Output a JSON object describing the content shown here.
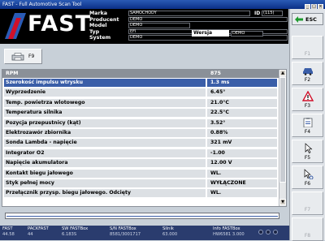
{
  "window": {
    "title": "FAST - Full Automotive Scan Tool"
  },
  "header": {
    "logo": "FAST",
    "labels": [
      "Marka",
      "Producent",
      "Model",
      "Typ",
      "System"
    ],
    "values": [
      "SAMOCHODY",
      "DEMO",
      "DEMO",
      "EFI",
      "DEMO"
    ],
    "id_label": "ID",
    "id_value": "(115)",
    "wersja_label": "Wersja",
    "wersja_value": "DEMO"
  },
  "toolbar": {
    "f9_label": "F9"
  },
  "table": {
    "header": {
      "name": "RPM",
      "value": "875"
    },
    "rows": [
      {
        "name": "Szerokość impulsu wtrysku",
        "value": "1.3 ms"
      },
      {
        "name": "Wyprzedzenie",
        "value": "6.45°"
      },
      {
        "name": "Temp. powietrza wlotowego",
        "value": "21.0°C"
      },
      {
        "name": "Temperatura silnika",
        "value": "22.5°C"
      },
      {
        "name": "Pozycja przepustnicy (kąt)",
        "value": "3.52°"
      },
      {
        "name": "Elektrozawór zbiornika",
        "value": "0.88%"
      },
      {
        "name": "Sonda Lambda - napięcie",
        "value": "321 mV"
      },
      {
        "name": "Integrator O2",
        "value": "-1.00"
      },
      {
        "name": "Napięcie akumulatora",
        "value": "12.00 V"
      },
      {
        "name": "Kontakt biegu jałowego",
        "value": "WL."
      },
      {
        "name": "Styk pełnej mocy",
        "value": "WYŁĄCZONE"
      },
      {
        "name": "Przełącznik przysp. biegu jałowego. Odcięty",
        "value": "WL."
      }
    ],
    "selected_row": 0
  },
  "sidebar": {
    "esc_label": "ESC",
    "buttons": [
      {
        "label": "F1",
        "icon": "none",
        "enabled": false
      },
      {
        "label": "F2",
        "icon": "car-icon",
        "enabled": true
      },
      {
        "label": "F3",
        "icon": "warning-icon",
        "enabled": true
      },
      {
        "label": "F4",
        "icon": "clipboard-icon",
        "enabled": true
      },
      {
        "label": "F5",
        "icon": "cursor-icon",
        "enabled": true
      },
      {
        "label": "F6",
        "icon": "cursor-settings-icon",
        "enabled": true
      },
      {
        "label": "F7",
        "icon": "none",
        "enabled": false
      },
      {
        "label": "F8",
        "icon": "none",
        "enabled": false
      }
    ]
  },
  "status": [
    {
      "label": "FAST",
      "value": "44.58"
    },
    {
      "label": "PACKFAST",
      "value": "44"
    },
    {
      "label": "SW FASTBox",
      "value": "6.183S"
    },
    {
      "label": "S/N FASTBox",
      "value": "8581/3001717"
    },
    {
      "label": "Silnik",
      "value": "63.000"
    },
    {
      "label": "Info FASTBox",
      "value": "HW6581 3.000"
    }
  ],
  "colors": {
    "selected_row": "#3a5ea8",
    "header_bg": "#000000",
    "status_bg": "#2a3c6e"
  }
}
